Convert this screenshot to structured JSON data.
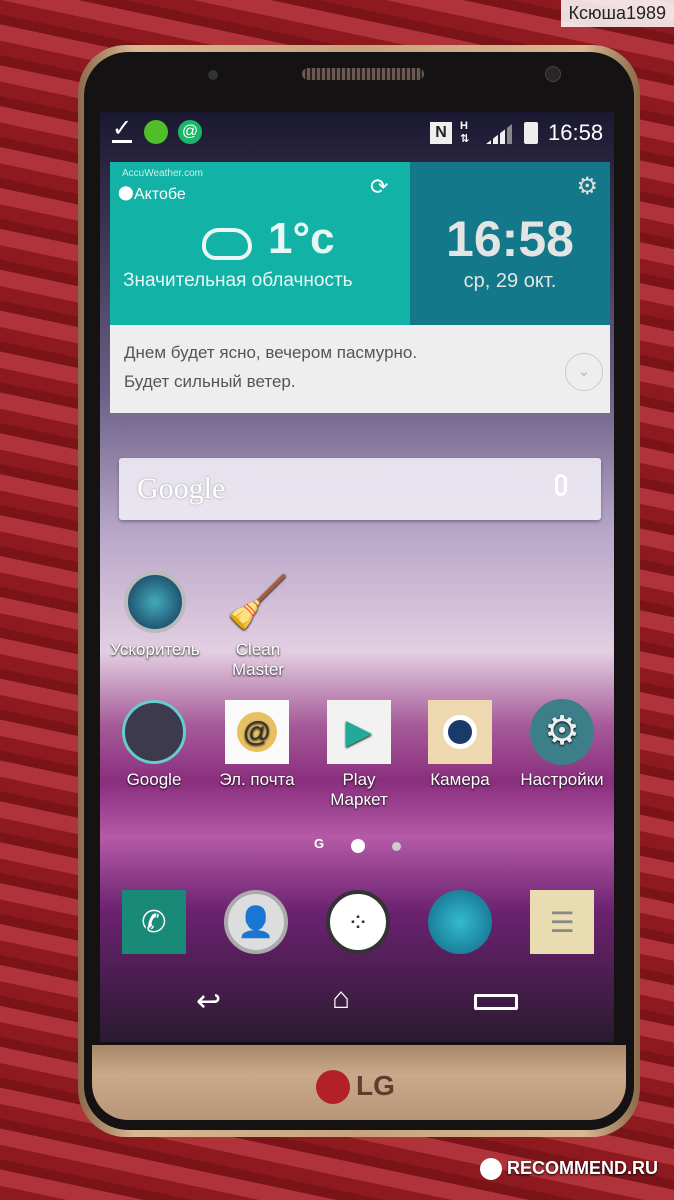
{
  "watermark_top": "Ксюша1989",
  "watermark_bottom": "RECOMMEND.RU",
  "brand": "LG",
  "status_bar": {
    "time": "16:58",
    "icons": [
      "download-done-icon",
      "antivirus-icon",
      "mail-agent-icon",
      "nfc-icon",
      "hspa-data-icon",
      "signal-icon",
      "battery-icon"
    ]
  },
  "weather": {
    "provider": "AccuWeather.com",
    "city": "Актобе",
    "temperature": "1°c",
    "condition": "Значительная облачность",
    "time": "16:58",
    "date": "ср, 29 окт.",
    "forecast_line1": "Днем будет ясно, вечером пасмурно.",
    "forecast_line2": "Будет сильный ветер.",
    "colors": {
      "left": "#13b2a6",
      "right": "#12788a"
    }
  },
  "search": {
    "placeholder": "Google"
  },
  "apps_row1": [
    {
      "label": "Ускоритель"
    },
    {
      "label": "Clean Master"
    }
  ],
  "apps_row2": [
    {
      "label": "Google"
    },
    {
      "label": "Эл. почта"
    },
    {
      "label": "Play Маркет"
    },
    {
      "label": "Камера"
    },
    {
      "label": "Настройки"
    }
  ],
  "page_indicator": {
    "google_page": "G",
    "current": 1,
    "total": 3
  },
  "dock": [
    "phone-icon",
    "contacts-icon",
    "apps-icon",
    "browser-icon",
    "messages-icon"
  ],
  "nav": [
    "back-icon",
    "home-icon",
    "recent-apps-icon"
  ]
}
